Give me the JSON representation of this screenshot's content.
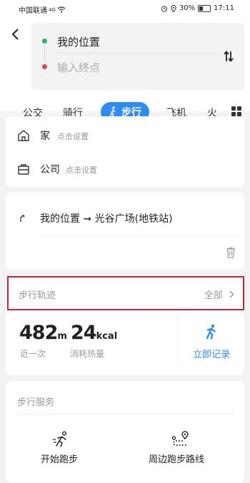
{
  "status_bar": {
    "carrier": "中国联通",
    "network": "4G",
    "battery": "30%",
    "time": "17:11"
  },
  "route": {
    "from": "我的位置",
    "to_placeholder": "输入终点"
  },
  "tabs": [
    {
      "label": "公交"
    },
    {
      "label": "骑行"
    },
    {
      "label": "步行"
    },
    {
      "label": "飞机"
    },
    {
      "label": "火"
    }
  ],
  "places": [
    {
      "name": "家",
      "hint": "点击设置",
      "icon": "home-icon"
    },
    {
      "name": "公司",
      "hint": "点击设置",
      "icon": "briefcase-icon"
    }
  ],
  "history": {
    "text": "我的位置 ➞ 光谷广场(地铁站)"
  },
  "track": {
    "title": "步行轨迹",
    "all_label": "全部"
  },
  "stats": {
    "distance_value": "482",
    "distance_unit": "m",
    "distance_label": "近一次",
    "calorie_value": "24",
    "calorie_unit": "kcal",
    "calorie_label": "消耗热量",
    "record_label": "立即记录"
  },
  "services": {
    "title": "步行服务",
    "items": [
      {
        "label": "开始跑步",
        "icon": "runner-icon"
      },
      {
        "label": "周边跑步路线",
        "icon": "route-pin-icon"
      }
    ]
  },
  "colors": {
    "accent": "#2e8cf0",
    "start_dot": "#29b46e",
    "end_dot": "#e1474a",
    "highlight_border": "#c5262e"
  }
}
